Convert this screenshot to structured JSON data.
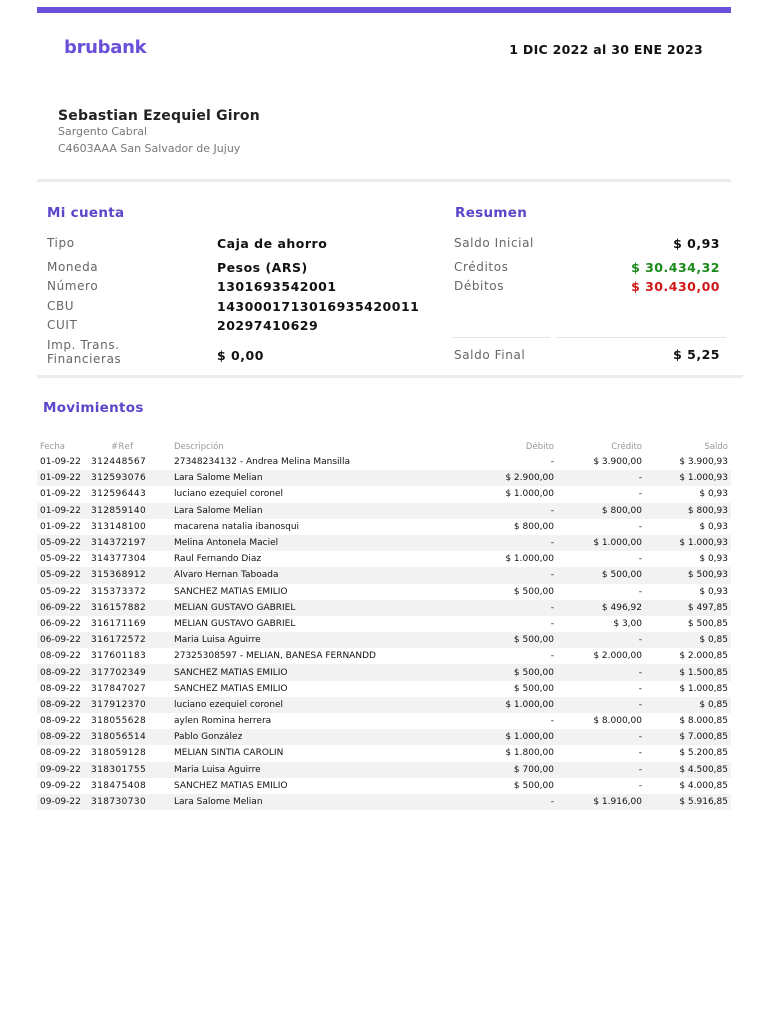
{
  "header": {
    "logo": "brubank",
    "period": "1 DIC 2022 al 30 ENE 2023",
    "accent_color": "#6a4fd8"
  },
  "holder": {
    "name": "Sebastian Ezequiel Giron",
    "address_line1": "Sargento Cabral",
    "address_line2": "C4603AAA San Salvador de Jujuy"
  },
  "account": {
    "title": "Mi cuenta",
    "fields": [
      {
        "label": "Tipo",
        "value": "Caja de ahorro"
      },
      {
        "label": "Moneda",
        "value": "Pesos (ARS)"
      },
      {
        "label": "Número",
        "value": "1301693542001"
      },
      {
        "label": "CBU",
        "value": "1430001713016935420011"
      },
      {
        "label": "CUIT",
        "value": "20297410629"
      }
    ],
    "imp_label_line1": "Imp. Trans.",
    "imp_label_line2": "Financieras",
    "imp_value": "$ 0,00"
  },
  "summary": {
    "title": "Resumen",
    "saldo_inicial_label": "Saldo Inicial",
    "saldo_inicial": "$ 0,93",
    "creditos_label": "Créditos",
    "creditos": "$ 30.434,32",
    "creditos_color": "#1a8a1a",
    "debitos_label": "Débitos",
    "debitos": "$ 30.430,00",
    "debitos_color": "#d01818",
    "saldo_final_label": "Saldo Final",
    "saldo_final": "$ 5,25"
  },
  "movements": {
    "title": "Movimientos",
    "columns": [
      "Fecha",
      "#Ref",
      "Descripción",
      "Débito",
      "Crédito",
      "Saldo"
    ],
    "rows": [
      [
        "01-09-22",
        "312448567",
        "27348234132 - Andrea Melina Mansilla",
        "-",
        "$ 3.900,00",
        "$ 3.900,93"
      ],
      [
        "01-09-22",
        "312593076",
        "Lara Salome Melian",
        "$ 2.900,00",
        "-",
        "$ 1.000,93"
      ],
      [
        "01-09-22",
        "312596443",
        "luciano ezequiel coronel",
        "$ 1.000,00",
        "-",
        "$ 0,93"
      ],
      [
        "01-09-22",
        "312859140",
        "Lara Salome Melian",
        "-",
        "$ 800,00",
        "$ 800,93"
      ],
      [
        "01-09-22",
        "313148100",
        "macarena natalia ibanosqui",
        "$ 800,00",
        "-",
        "$ 0,93"
      ],
      [
        "05-09-22",
        "314372197",
        "Melina Antonela Maciel",
        "-",
        "$ 1.000,00",
        "$ 1.000,93"
      ],
      [
        "05-09-22",
        "314377304",
        "Raul Fernando Diaz",
        "$ 1.000,00",
        "-",
        "$ 0,93"
      ],
      [
        "05-09-22",
        "315368912",
        "Alvaro Hernan Taboada",
        "-",
        "$ 500,00",
        "$ 500,93"
      ],
      [
        "05-09-22",
        "315373372",
        "SANCHEZ MATIAS EMILIO",
        "$ 500,00",
        "-",
        "$ 0,93"
      ],
      [
        "06-09-22",
        "316157882",
        "MELIAN GUSTAVO GABRIEL",
        "-",
        "$ 496,92",
        "$ 497,85"
      ],
      [
        "06-09-22",
        "316171169",
        "MELIAN GUSTAVO GABRIEL",
        "-",
        "$ 3,00",
        "$ 500,85"
      ],
      [
        "06-09-22",
        "316172572",
        "Maria Luisa Aguirre",
        "$ 500,00",
        "-",
        "$ 0,85"
      ],
      [
        "08-09-22",
        "317601183",
        "27325308597 - MELIAN, BANESA FERNANDD",
        "-",
        "$ 2.000,00",
        "$ 2.000,85"
      ],
      [
        "08-09-22",
        "317702349",
        "SANCHEZ MATIAS EMILIO",
        "$ 500,00",
        "-",
        "$ 1.500,85"
      ],
      [
        "08-09-22",
        "317847027",
        "SANCHEZ MATIAS EMILIO",
        "$ 500,00",
        "-",
        "$ 1.000,85"
      ],
      [
        "08-09-22",
        "317912370",
        "luciano ezequiel coronel",
        "$ 1.000,00",
        "-",
        "$ 0,85"
      ],
      [
        "08-09-22",
        "318055628",
        "aylen Romina herrera",
        "-",
        "$ 8.000,00",
        "$ 8.000,85"
      ],
      [
        "08-09-22",
        "318056514",
        "Pablo González",
        "$ 1.000,00",
        "-",
        "$ 7.000,85"
      ],
      [
        "08-09-22",
        "318059128",
        "MELIAN SINTIA CAROLIN",
        "$ 1.800,00",
        "-",
        "$ 5.200,85"
      ],
      [
        "09-09-22",
        "318301755",
        "Maria Luisa Aguirre",
        "$ 700,00",
        "-",
        "$ 4.500,85"
      ],
      [
        "09-09-22",
        "318475408",
        "SANCHEZ MATIAS EMILIO",
        "$ 500,00",
        "-",
        "$ 4.000,85"
      ],
      [
        "09-09-22",
        "318730730",
        "Lara Salome Melian",
        "-",
        "$ 1.916,00",
        "$ 5.916,85"
      ]
    ]
  }
}
